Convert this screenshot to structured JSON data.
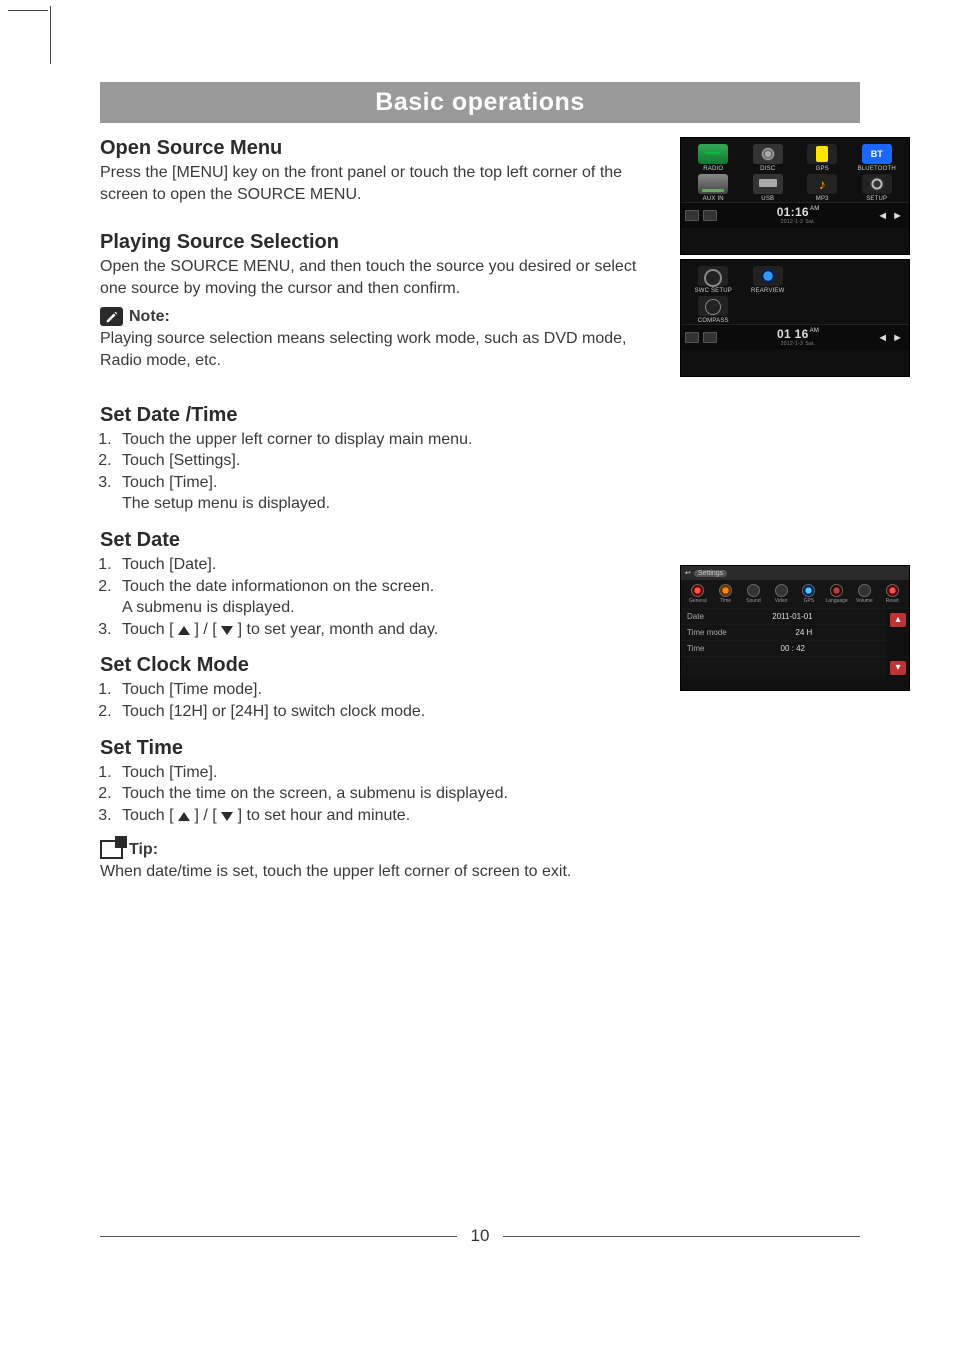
{
  "page": {
    "title": "Basic operations",
    "page_number": "10"
  },
  "sections": {
    "open_source_menu": {
      "heading": "Open Source Menu",
      "body": "Press the [MENU] key on the front panel or touch the top left corner of the screen to open the SOURCE MENU."
    },
    "playing_source_selection": {
      "heading": "Playing Source Selection",
      "body": "Open the SOURCE MENU, and then touch the source you desired or select one source by moving the cursor and then confirm."
    },
    "note": {
      "label": "Note:",
      "body": "Playing source selection means selecting work mode, such as  DVD mode, Radio mode, etc."
    },
    "set_date_time": {
      "heading": "Set Date /Time",
      "items": [
        "Touch the upper left corner to display main menu.",
        "Touch [Settings].",
        "Touch [Time]."
      ],
      "sub": "The setup menu is displayed."
    },
    "set_date": {
      "heading": "Set Date",
      "items_pre": [
        "Touch [Date].",
        "Touch the date informationon on the screen."
      ],
      "sub": "A submenu is displayed.",
      "item3_pre": "Touch [ ",
      "item3_mid": " ] / [ ",
      "item3_post": " ] to set year, month and day."
    },
    "set_clock_mode": {
      "heading": "Set Clock Mode",
      "items": [
        "Touch [Time mode].",
        "Touch [12H] or [24H] to switch clock mode."
      ]
    },
    "set_time": {
      "heading": "Set Time",
      "items_pre": [
        "Touch [Time].",
        "Touch the time on the screen, a submenu is displayed."
      ],
      "item3_pre": "Touch [ ",
      "item3_mid": " ] / [ ",
      "item3_post": " ] to set hour and minute."
    },
    "tip": {
      "label": "Tip:",
      "body": "When date/time is set, touch the upper left corner of screen to exit."
    }
  },
  "thumbnails": {
    "src_menu": {
      "row1": [
        "RADIO",
        "DISC",
        "GPS",
        "BLUETOOTH"
      ],
      "row2": [
        "AUX IN",
        "USB",
        "MP3",
        "SETUP"
      ],
      "bt_label": "BT",
      "clock_time": "01:16",
      "clock_ampm": "AM",
      "clock_sub1": "2012-1-3",
      "clock_sub2": "Sat."
    },
    "src_menu2": {
      "row1": [
        "SWC SETUP",
        "REARVIEW",
        "",
        ""
      ],
      "row2": [
        "COMPASS",
        "",
        "",
        ""
      ],
      "clock_time": "01 16",
      "clock_ampm": "AM",
      "clock_sub1": "2012-1-3",
      "clock_sub2": "Sat."
    },
    "settings": {
      "title": "Settings",
      "tabs": [
        "General",
        "Time",
        "Sound",
        "Video",
        "GPS",
        "Language",
        "Volume",
        "Reset"
      ],
      "rows": [
        {
          "label": "Date",
          "value": "2011-01-01"
        },
        {
          "label": "Time mode",
          "value": "24 H"
        },
        {
          "label": "Time",
          "value": "00 : 42"
        }
      ]
    }
  }
}
